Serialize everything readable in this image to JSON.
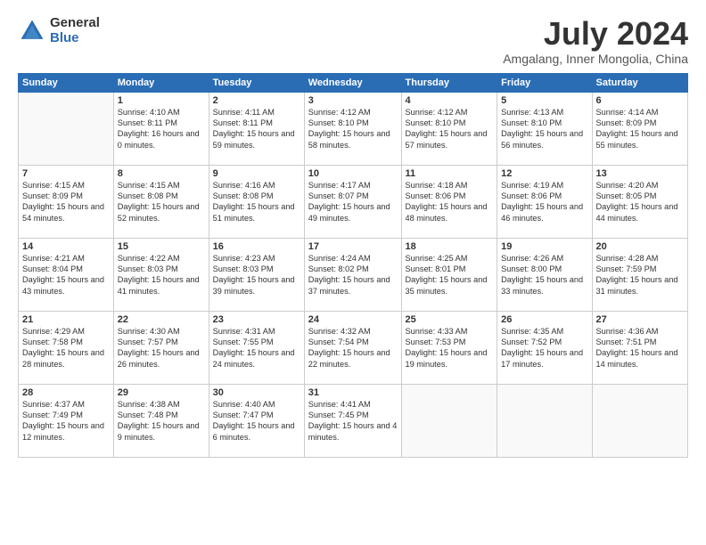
{
  "header": {
    "logo_general": "General",
    "logo_blue": "Blue",
    "month_year": "July 2024",
    "location": "Amgalang, Inner Mongolia, China"
  },
  "weekdays": [
    "Sunday",
    "Monday",
    "Tuesday",
    "Wednesday",
    "Thursday",
    "Friday",
    "Saturday"
  ],
  "weeks": [
    [
      {
        "day": "",
        "sunrise": "",
        "sunset": "",
        "daylight": ""
      },
      {
        "day": "1",
        "sunrise": "Sunrise: 4:10 AM",
        "sunset": "Sunset: 8:11 PM",
        "daylight": "Daylight: 16 hours and 0 minutes."
      },
      {
        "day": "2",
        "sunrise": "Sunrise: 4:11 AM",
        "sunset": "Sunset: 8:11 PM",
        "daylight": "Daylight: 15 hours and 59 minutes."
      },
      {
        "day": "3",
        "sunrise": "Sunrise: 4:12 AM",
        "sunset": "Sunset: 8:10 PM",
        "daylight": "Daylight: 15 hours and 58 minutes."
      },
      {
        "day": "4",
        "sunrise": "Sunrise: 4:12 AM",
        "sunset": "Sunset: 8:10 PM",
        "daylight": "Daylight: 15 hours and 57 minutes."
      },
      {
        "day": "5",
        "sunrise": "Sunrise: 4:13 AM",
        "sunset": "Sunset: 8:10 PM",
        "daylight": "Daylight: 15 hours and 56 minutes."
      },
      {
        "day": "6",
        "sunrise": "Sunrise: 4:14 AM",
        "sunset": "Sunset: 8:09 PM",
        "daylight": "Daylight: 15 hours and 55 minutes."
      }
    ],
    [
      {
        "day": "7",
        "sunrise": "Sunrise: 4:15 AM",
        "sunset": "Sunset: 8:09 PM",
        "daylight": "Daylight: 15 hours and 54 minutes."
      },
      {
        "day": "8",
        "sunrise": "Sunrise: 4:15 AM",
        "sunset": "Sunset: 8:08 PM",
        "daylight": "Daylight: 15 hours and 52 minutes."
      },
      {
        "day": "9",
        "sunrise": "Sunrise: 4:16 AM",
        "sunset": "Sunset: 8:08 PM",
        "daylight": "Daylight: 15 hours and 51 minutes."
      },
      {
        "day": "10",
        "sunrise": "Sunrise: 4:17 AM",
        "sunset": "Sunset: 8:07 PM",
        "daylight": "Daylight: 15 hours and 49 minutes."
      },
      {
        "day": "11",
        "sunrise": "Sunrise: 4:18 AM",
        "sunset": "Sunset: 8:06 PM",
        "daylight": "Daylight: 15 hours and 48 minutes."
      },
      {
        "day": "12",
        "sunrise": "Sunrise: 4:19 AM",
        "sunset": "Sunset: 8:06 PM",
        "daylight": "Daylight: 15 hours and 46 minutes."
      },
      {
        "day": "13",
        "sunrise": "Sunrise: 4:20 AM",
        "sunset": "Sunset: 8:05 PM",
        "daylight": "Daylight: 15 hours and 44 minutes."
      }
    ],
    [
      {
        "day": "14",
        "sunrise": "Sunrise: 4:21 AM",
        "sunset": "Sunset: 8:04 PM",
        "daylight": "Daylight: 15 hours and 43 minutes."
      },
      {
        "day": "15",
        "sunrise": "Sunrise: 4:22 AM",
        "sunset": "Sunset: 8:03 PM",
        "daylight": "Daylight: 15 hours and 41 minutes."
      },
      {
        "day": "16",
        "sunrise": "Sunrise: 4:23 AM",
        "sunset": "Sunset: 8:03 PM",
        "daylight": "Daylight: 15 hours and 39 minutes."
      },
      {
        "day": "17",
        "sunrise": "Sunrise: 4:24 AM",
        "sunset": "Sunset: 8:02 PM",
        "daylight": "Daylight: 15 hours and 37 minutes."
      },
      {
        "day": "18",
        "sunrise": "Sunrise: 4:25 AM",
        "sunset": "Sunset: 8:01 PM",
        "daylight": "Daylight: 15 hours and 35 minutes."
      },
      {
        "day": "19",
        "sunrise": "Sunrise: 4:26 AM",
        "sunset": "Sunset: 8:00 PM",
        "daylight": "Daylight: 15 hours and 33 minutes."
      },
      {
        "day": "20",
        "sunrise": "Sunrise: 4:28 AM",
        "sunset": "Sunset: 7:59 PM",
        "daylight": "Daylight: 15 hours and 31 minutes."
      }
    ],
    [
      {
        "day": "21",
        "sunrise": "Sunrise: 4:29 AM",
        "sunset": "Sunset: 7:58 PM",
        "daylight": "Daylight: 15 hours and 28 minutes."
      },
      {
        "day": "22",
        "sunrise": "Sunrise: 4:30 AM",
        "sunset": "Sunset: 7:57 PM",
        "daylight": "Daylight: 15 hours and 26 minutes."
      },
      {
        "day": "23",
        "sunrise": "Sunrise: 4:31 AM",
        "sunset": "Sunset: 7:55 PM",
        "daylight": "Daylight: 15 hours and 24 minutes."
      },
      {
        "day": "24",
        "sunrise": "Sunrise: 4:32 AM",
        "sunset": "Sunset: 7:54 PM",
        "daylight": "Daylight: 15 hours and 22 minutes."
      },
      {
        "day": "25",
        "sunrise": "Sunrise: 4:33 AM",
        "sunset": "Sunset: 7:53 PM",
        "daylight": "Daylight: 15 hours and 19 minutes."
      },
      {
        "day": "26",
        "sunrise": "Sunrise: 4:35 AM",
        "sunset": "Sunset: 7:52 PM",
        "daylight": "Daylight: 15 hours and 17 minutes."
      },
      {
        "day": "27",
        "sunrise": "Sunrise: 4:36 AM",
        "sunset": "Sunset: 7:51 PM",
        "daylight": "Daylight: 15 hours and 14 minutes."
      }
    ],
    [
      {
        "day": "28",
        "sunrise": "Sunrise: 4:37 AM",
        "sunset": "Sunset: 7:49 PM",
        "daylight": "Daylight: 15 hours and 12 minutes."
      },
      {
        "day": "29",
        "sunrise": "Sunrise: 4:38 AM",
        "sunset": "Sunset: 7:48 PM",
        "daylight": "Daylight: 15 hours and 9 minutes."
      },
      {
        "day": "30",
        "sunrise": "Sunrise: 4:40 AM",
        "sunset": "Sunset: 7:47 PM",
        "daylight": "Daylight: 15 hours and 6 minutes."
      },
      {
        "day": "31",
        "sunrise": "Sunrise: 4:41 AM",
        "sunset": "Sunset: 7:45 PM",
        "daylight": "Daylight: 15 hours and 4 minutes."
      },
      {
        "day": "",
        "sunrise": "",
        "sunset": "",
        "daylight": ""
      },
      {
        "day": "",
        "sunrise": "",
        "sunset": "",
        "daylight": ""
      },
      {
        "day": "",
        "sunrise": "",
        "sunset": "",
        "daylight": ""
      }
    ]
  ]
}
